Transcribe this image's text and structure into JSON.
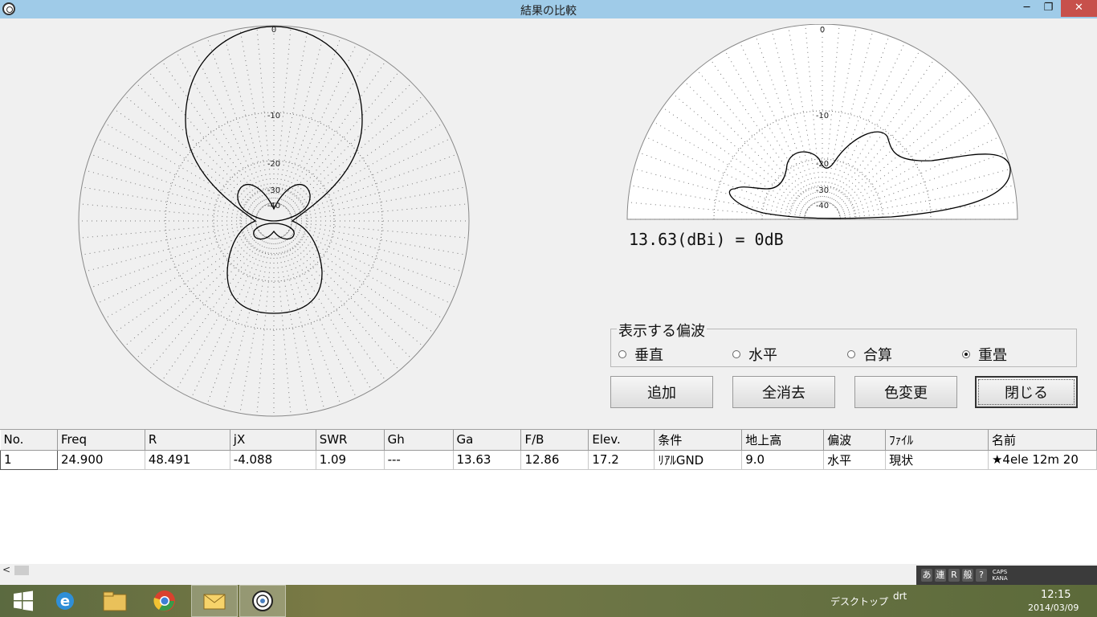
{
  "window": {
    "title": "結果の比較",
    "minimize_glyph": "─",
    "restore_glyph": "❐",
    "close_glyph": "✕"
  },
  "azimuth_plot": {
    "ring_labels": [
      "0",
      "-10",
      "-20",
      "-30",
      "-40"
    ]
  },
  "elevation_plot": {
    "ring_labels": [
      "0",
      "-10",
      "-20",
      "-30",
      "-40"
    ]
  },
  "gain_readout": "13.63(dBi) = 0dB",
  "polarization": {
    "legend": "表示する偏波",
    "options": [
      {
        "label": "垂直",
        "checked": false
      },
      {
        "label": "水平",
        "checked": false
      },
      {
        "label": "合算",
        "checked": false
      },
      {
        "label": "重畳",
        "checked": true
      }
    ]
  },
  "buttons": {
    "add": "追加",
    "clear_all": "全消去",
    "change_color": "色変更",
    "close": "閉じる"
  },
  "table": {
    "columns": [
      "No.",
      "Freq",
      "R",
      "jX",
      "SWR",
      "Gh",
      "Ga",
      "F/B",
      "Elev.",
      "条件",
      "地上高",
      "偏波",
      "ﾌｧｲﾙ",
      "名前"
    ],
    "rows": [
      [
        "1",
        "24.900",
        "48.491",
        "-4.088",
        "1.09",
        "---",
        "13.63",
        "12.86",
        "17.2",
        "ﾘｱﾙGND",
        "9.0",
        "水平",
        "現状",
        "★4ele 12m  20"
      ]
    ]
  },
  "scrollbar": {
    "left_arrow": "<"
  },
  "ime_toolbar": [
    "あ",
    "連",
    "R",
    "般",
    "?",
    "CAPS KANA"
  ],
  "taskbar": {
    "desktop_label": "デスクトップ",
    "folder_label": "drt",
    "time": "12:15",
    "date": "2014/03/09"
  },
  "colors": {
    "titlebar": "#9fcbe8",
    "close_button": "#c7504b",
    "pattern_line": "#000000",
    "grid_line": "#666666"
  }
}
